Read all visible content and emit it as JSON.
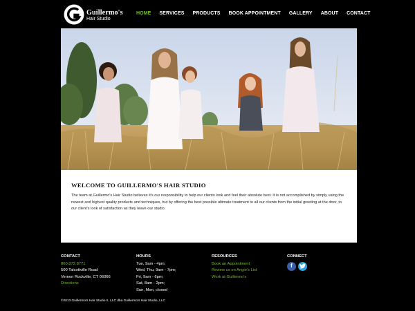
{
  "brand": {
    "name": "Guillermo's",
    "subtitle": "Hair Studio"
  },
  "nav": [
    {
      "label": "HOME",
      "active": true
    },
    {
      "label": "SERVICES",
      "active": false
    },
    {
      "label": "PRODUCTS",
      "active": false
    },
    {
      "label": "BOOK APPOINTMENT",
      "active": false
    },
    {
      "label": "GALLERY",
      "active": false
    },
    {
      "label": "ABOUT",
      "active": false
    },
    {
      "label": "CONTACT",
      "active": false
    }
  ],
  "welcome": {
    "title": "WELCOME TO GUILLERMO'S HAIR STUDIO",
    "body": "The team at Guillermo's Hair Studio believes it's our responsibility to help our clients look and feel their absolute best. It is not accomplished by simply using the newest and highest quality products and techniques, but by offering the best possible ultimate treatment to all our clients from the initial greeting at the door, to our client's look of satisfaction as they leave our studio."
  },
  "footer": {
    "contact": {
      "heading": "CONTACT",
      "phone": "860.872.8771",
      "address1": "500 Talcottville Road",
      "address2": "Vernon Rockville, CT 06066",
      "directions": "Directions"
    },
    "hours": {
      "heading": "HOURS",
      "lines": [
        "Tue, 9am - 4pm;",
        "Wed, Thu, 9am - 7pm;",
        "Fri, 9am - 6pm;",
        "Sat, 8am - 2pm;",
        "Sun, Mon, closed"
      ]
    },
    "resources": {
      "heading": "RESOURCES",
      "links": [
        "Book an Appointment",
        "Review us on Angie's List",
        "Work at Guillermo's"
      ]
    },
    "connect": {
      "heading": "CONNECT",
      "icons": [
        "facebook-icon",
        "twitter-icon"
      ]
    },
    "copyright": "©2013 Guillermo's Hair Studio II, LLC dba Guillermo's Hair Studio, LLC"
  },
  "colors": {
    "accent": "#79b82f",
    "background": "#000000",
    "panel": "#ffffff"
  }
}
